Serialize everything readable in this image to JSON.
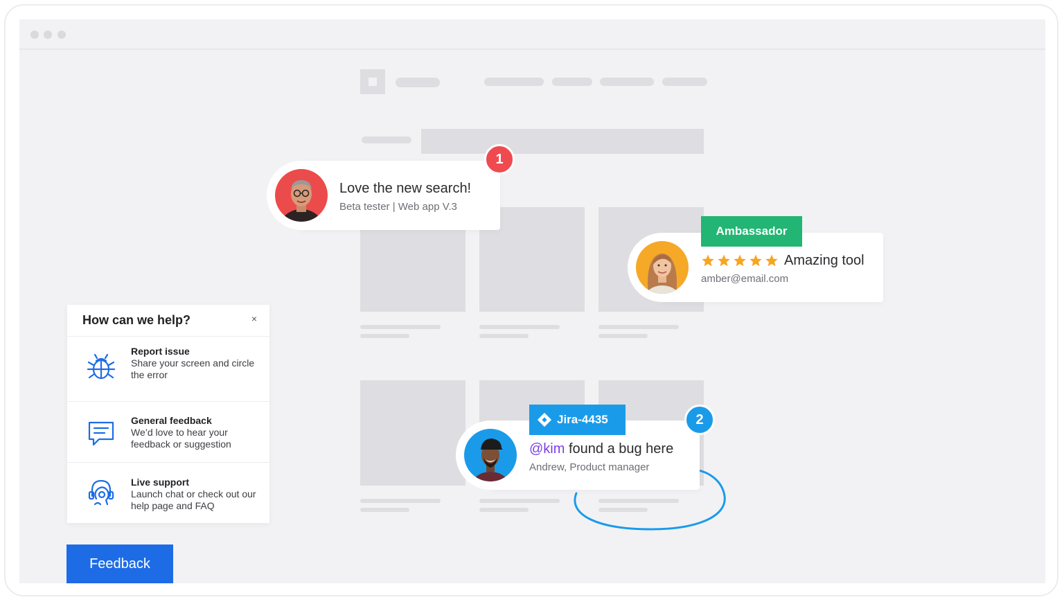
{
  "popups": {
    "search_feedback": {
      "title": "Love the new search!",
      "subtitle": "Beta tester | Web app V.3",
      "count": "1",
      "count_color": "#ef4a4f"
    },
    "ambassador_feedback": {
      "tag": "Ambassador",
      "tag_color": "#22b573",
      "stars": 5,
      "title": "Amazing tool",
      "subtitle": "amber@email.com",
      "star_color": "#f6a623"
    },
    "bug_feedback": {
      "jira_label": "Jira-4435",
      "jira_color": "#1a9bea",
      "mention": "@kim",
      "title_rest": " found a bug here",
      "subtitle": "Andrew, Product manager",
      "count": "2",
      "count_color": "#1a9bea",
      "mention_color": "#7b3fe4"
    }
  },
  "help_panel": {
    "title": "How can we help?",
    "close_label": "×",
    "items": [
      {
        "heading": "Report issue",
        "description": "Share your screen and circle the error",
        "icon": "bug-icon"
      },
      {
        "heading": "General feedback",
        "description": "We’d love to hear your feedback or suggestion",
        "icon": "chat-bubble-icon"
      },
      {
        "heading": "Live support",
        "description": "Launch chat or check out our help page and FAQ",
        "icon": "headset-icon"
      }
    ]
  },
  "feedback_button": {
    "label": "Feedback",
    "color": "#1d6ce6"
  },
  "accent_circle_color": "#1a9bea"
}
